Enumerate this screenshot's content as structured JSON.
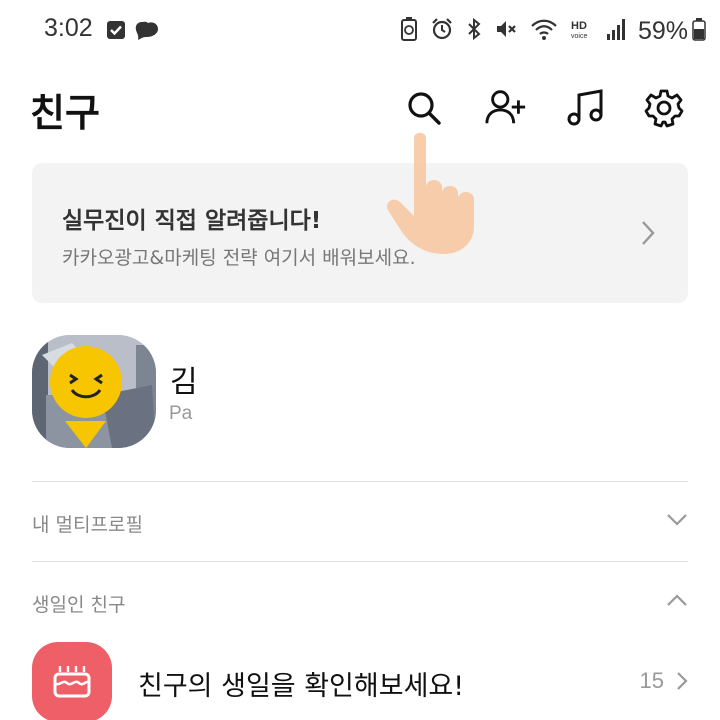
{
  "status_bar": {
    "time": "3:02",
    "battery": "59%",
    "icons": [
      "checkbox-notification-icon",
      "chat-bubble-icon",
      "battery-saver-icon",
      "alarm-icon",
      "bluetooth-icon",
      "mute-icon",
      "wifi-icon",
      "hd-voice-icon",
      "signal-icon",
      "battery-icon"
    ]
  },
  "header": {
    "title": "친구",
    "icons": [
      "search-icon",
      "add-friend-icon",
      "music-icon",
      "settings-icon"
    ]
  },
  "banner": {
    "title": "실무진이 직접 알려줍니다!",
    "subtitle": "카카오광고&마케팅 전략 여기서 배워보세요."
  },
  "profile": {
    "name": "김",
    "status": "Pa"
  },
  "sections": {
    "multi_profile": "내 멀티프로필",
    "birthday": "생일인 친구"
  },
  "birthday_row": {
    "text": "친구의 생일을 확인해보세요!",
    "count": "15"
  },
  "colors": {
    "accent_birthday": "#ee5f67",
    "banner_bg": "#f3f3f3",
    "emoji_yellow": "#f7c600"
  }
}
